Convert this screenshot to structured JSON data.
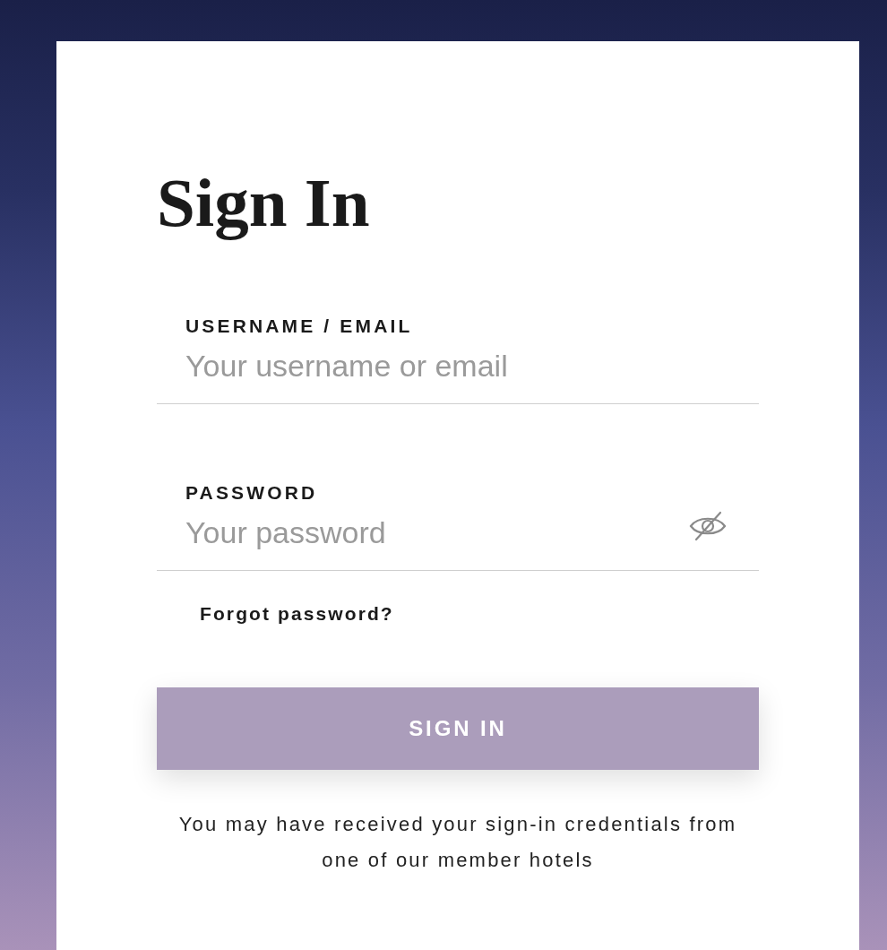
{
  "title": "Sign In",
  "fields": [
    {
      "kind": "text",
      "label": "USERNAME / EMAIL",
      "placeholder": "Your username or email"
    },
    {
      "kind": "password",
      "label": "PASSWORD",
      "placeholder": "Your password",
      "masked": true
    }
  ],
  "forgot_link": "Forgot password?",
  "submit_button": "SIGN IN",
  "note": "You may have received your sign-in credentials from one of our member hotels"
}
